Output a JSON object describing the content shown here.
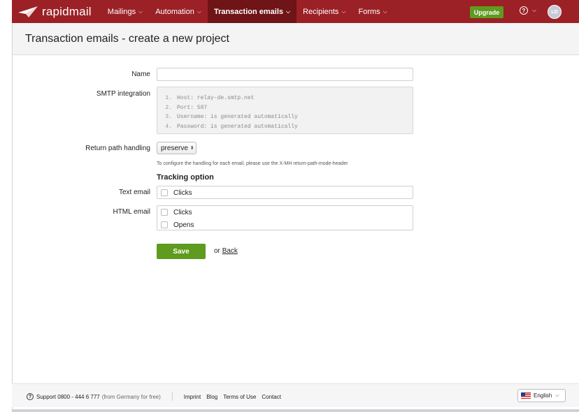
{
  "brand": {
    "name": "rapidmail"
  },
  "nav": {
    "items": [
      {
        "label": "Mailings",
        "active": false
      },
      {
        "label": "Automation",
        "active": false
      },
      {
        "label": "Transaction emails",
        "active": true
      },
      {
        "label": "Recipients",
        "active": false
      },
      {
        "label": "Forms",
        "active": false
      }
    ],
    "upgrade_label": "Upgrade",
    "help_icon": "question-circle-icon",
    "avatar_initials": "LD"
  },
  "page": {
    "title": "Transaction emails - create a new project"
  },
  "form": {
    "name_label": "Name",
    "name_value": "",
    "smtp_label": "SMTP integration",
    "smtp_lines": [
      {
        "num": "1.",
        "text": "Host: relay-de.smtp.net"
      },
      {
        "num": "2.",
        "text": "Port: 587"
      },
      {
        "num": "3.",
        "text": "Username: is generated automatically"
      },
      {
        "num": "4.",
        "text": "Password: is generated automatically"
      }
    ],
    "return_path_label": "Return path handling",
    "return_path_value": "preserve",
    "hint": "To configure the handling for each email, please use the X-MH return-path-mode-header",
    "tracking_title": "Tracking option",
    "text_email_label": "Text email",
    "text_email_options": [
      {
        "label": "Clicks",
        "checked": false
      }
    ],
    "html_email_label": "HTML email",
    "html_email_options": [
      {
        "label": "Clicks",
        "checked": false
      },
      {
        "label": "Opens",
        "checked": false
      }
    ],
    "save_label": "Save",
    "or_text": "or",
    "back_label": "Back"
  },
  "footer": {
    "support_label": "Support 0800 - 444 6 777",
    "support_note": "(from Germany for free)",
    "links": [
      "Imprint",
      "Blog",
      "Terms of Use",
      "Contact"
    ],
    "language": "English"
  },
  "colors": {
    "brand": "#9b2126",
    "active_nav": "#6f1417",
    "primary_button": "#5e9b1e"
  }
}
